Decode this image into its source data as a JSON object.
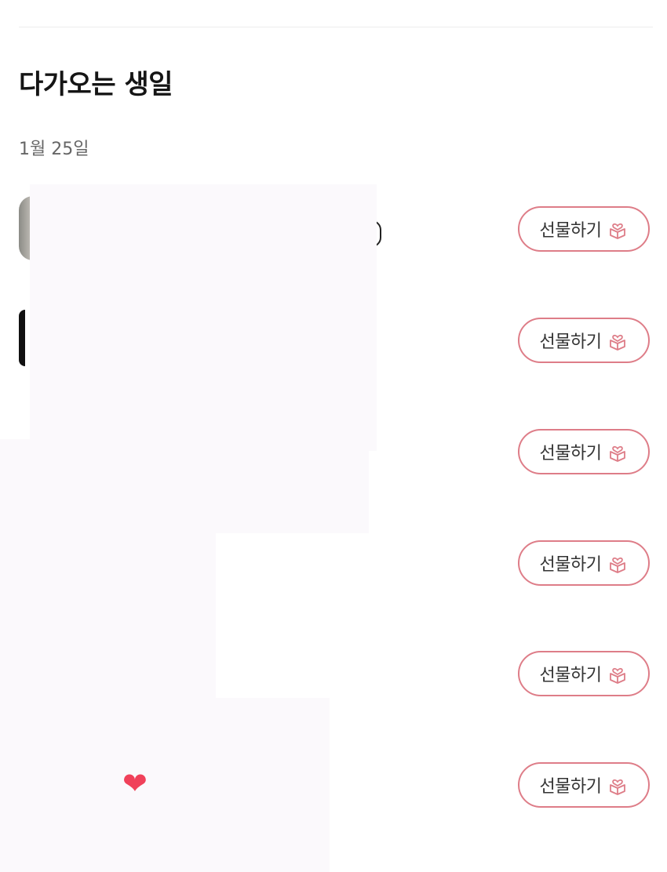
{
  "section": {
    "title": "다가오는 생일",
    "date": "1월 25일"
  },
  "gift_buttons": [
    {
      "label": "선물하기"
    },
    {
      "label": "선물하기"
    },
    {
      "label": "선물하기"
    },
    {
      "label": "선물하기"
    },
    {
      "label": "선물하기"
    },
    {
      "label": "선물하기"
    }
  ],
  "icons": {
    "gift": "gift-box-heart-icon",
    "heart": "heart-icon"
  },
  "colors": {
    "accent": "#de7d88",
    "heart": "#f0415a"
  }
}
